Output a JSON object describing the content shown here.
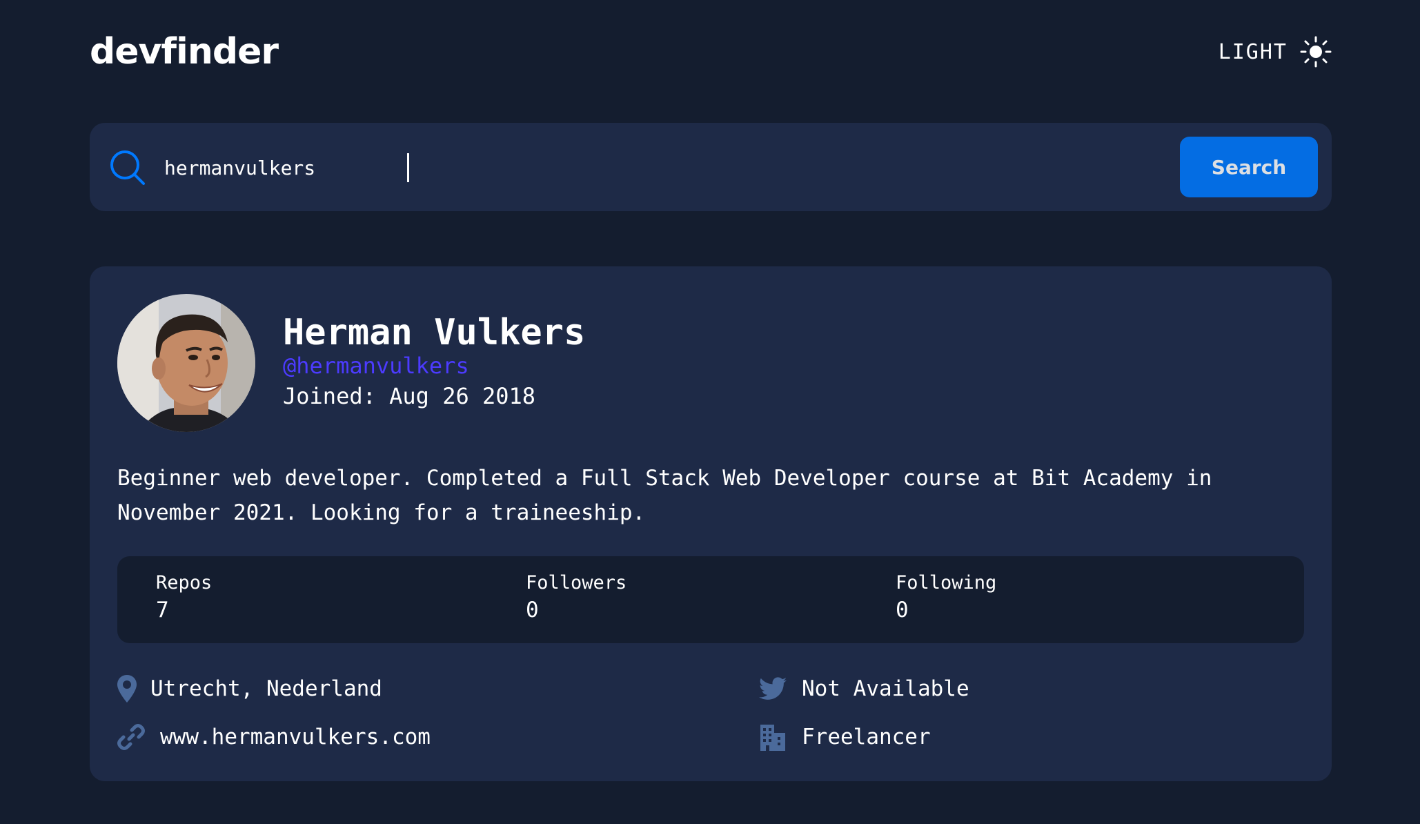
{
  "app": {
    "title": "devfinder"
  },
  "theme_toggle": {
    "label": "LIGHT",
    "icon": "sun-icon"
  },
  "search": {
    "value": "hermanvulkers",
    "button_label": "Search",
    "icon": "search-icon"
  },
  "profile": {
    "avatar": "avatar-photo",
    "name": "Herman Vulkers",
    "handle": "@hermanvulkers",
    "joined": "Joined: Aug 26 2018",
    "bio": "Beginner web developer. Completed a Full Stack Web Developer course at Bit Academy in November 2021. Looking for a traineeship."
  },
  "stats": [
    {
      "label": "Repos",
      "value": "7"
    },
    {
      "label": "Followers",
      "value": "0"
    },
    {
      "label": "Following",
      "value": "0"
    }
  ],
  "links": {
    "location": {
      "icon": "location-pin-icon",
      "text": "Utrecht, Nederland"
    },
    "twitter": {
      "icon": "twitter-icon",
      "text": "Not Available"
    },
    "website": {
      "icon": "link-icon",
      "text": "www.hermanvulkers.com"
    },
    "company": {
      "icon": "building-icon",
      "text": "Freelancer"
    }
  },
  "colors": {
    "background": "#141D2F",
    "card": "#1E2A47",
    "accent": "#0079FF",
    "handle": "#4C3BFF",
    "icon": "#4B6A9B"
  }
}
